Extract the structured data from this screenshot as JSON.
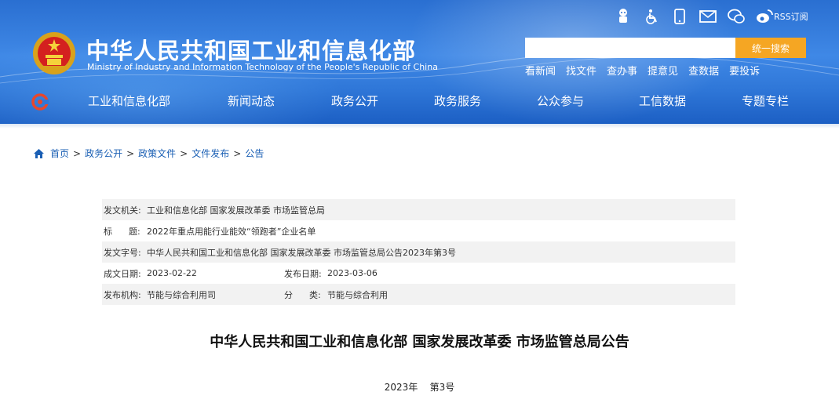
{
  "header": {
    "title": "中华人民共和国工业和信息化部",
    "subtitle": "Ministry of Industry and Information Technology of the People's Republic of China",
    "tool_icons": [
      "accessibility-robot-icon",
      "wheelchair-icon",
      "mobile-phone-icon",
      "mail-icon",
      "wechat-icon",
      "weibo-icon"
    ],
    "rss_label": "RSS订阅",
    "search_button": "统一搜索",
    "search_placeholder": "",
    "quick_links": [
      "看新闻",
      "找文件",
      "查办事",
      "提意见",
      "查数据",
      "要投诉"
    ],
    "brand_color": "#2a6fd1",
    "accent_color": "#f5a623"
  },
  "nav": {
    "items": [
      "工业和信息化部",
      "新闻动态",
      "政务公开",
      "政务服务",
      "公众参与",
      "工信数据",
      "专题专栏"
    ]
  },
  "breadcrumb": {
    "items": [
      "首页",
      "政务公开",
      "政策文件",
      "文件发布",
      "公告"
    ],
    "separator": ">"
  },
  "info": {
    "issuer_label": "发文机关:",
    "issuer_value": "工业和信息化部 国家发展改革委 市场监管总局",
    "title_label": "标      题:",
    "title_value": "2022年重点用能行业能效“领跑者”企业名单",
    "doc_no_label": "发文字号:",
    "doc_no_value": "中华人民共和国工业和信息化部 国家发展改革委 市场监管总局公告2023年第3号",
    "written_date_label": "成文日期:",
    "written_date_value": "2023-02-22",
    "publish_date_label": "发布日期:",
    "publish_date_value": "2023-03-06",
    "agency_label": "发布机构:",
    "agency_value": "节能与综合利用司",
    "category_label": "分      类:",
    "category_value": "节能与综合利用"
  },
  "document": {
    "title": "中华人民共和国工业和信息化部 国家发展改革委 市场监管总局公告",
    "number": "2023年    第3号"
  }
}
